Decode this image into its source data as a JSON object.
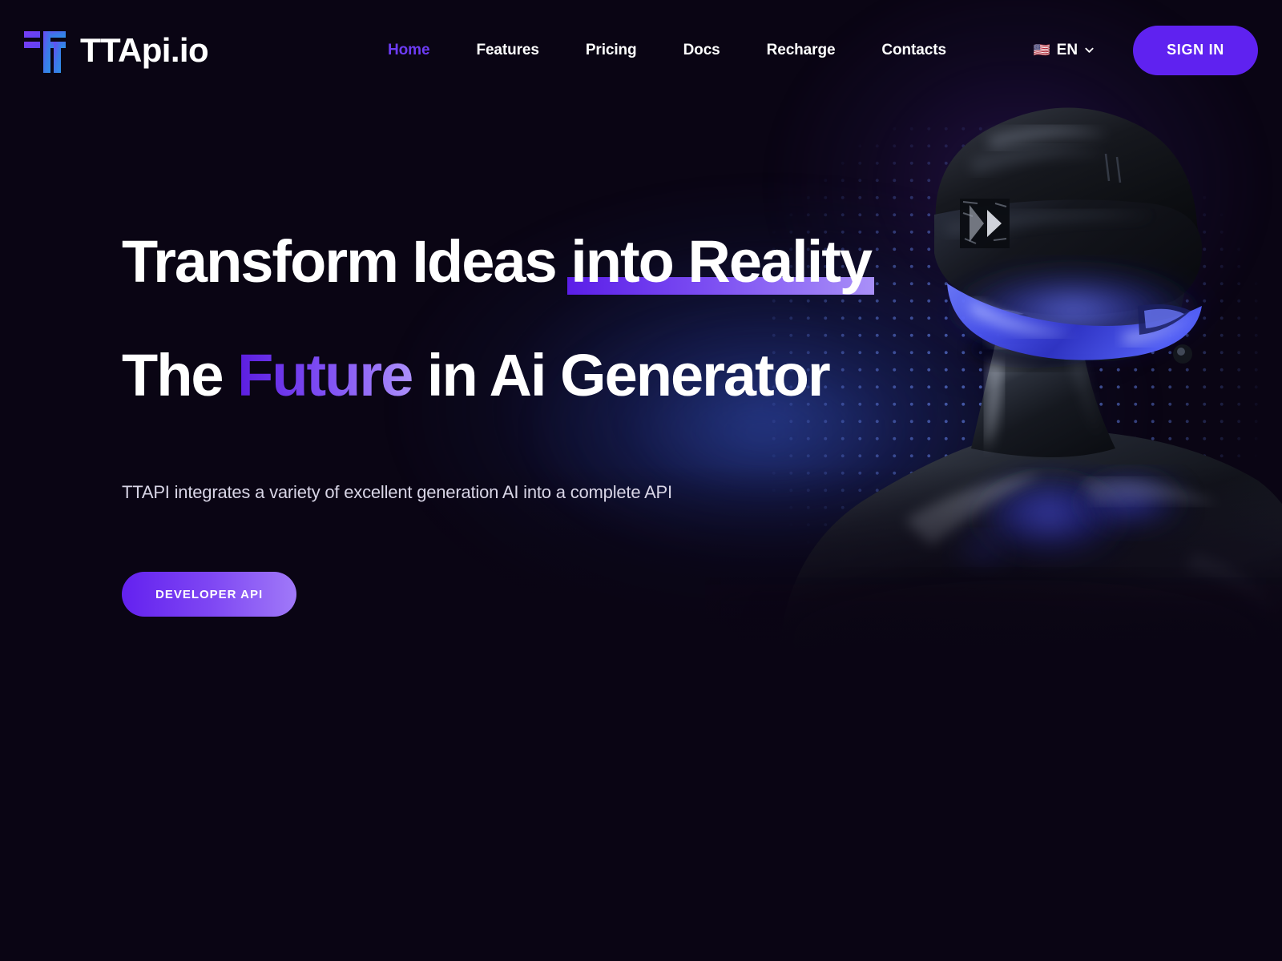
{
  "brand": {
    "name": "TTApi.io",
    "logo_icon": "ttapi-logo-icon",
    "logo_colors": {
      "accent_purple": "#6d3cf5",
      "accent_blue": "#2f7fe8"
    }
  },
  "nav": {
    "items": [
      {
        "label": "Home",
        "active": true
      },
      {
        "label": "Features",
        "active": false
      },
      {
        "label": "Pricing",
        "active": false
      },
      {
        "label": "Docs",
        "active": false
      },
      {
        "label": "Recharge",
        "active": false
      },
      {
        "label": "Contacts",
        "active": false
      }
    ]
  },
  "header": {
    "language": {
      "flag_icon": "us-flag-icon",
      "flag": "🇺🇸",
      "code": "EN",
      "chevron_icon": "chevron-down-icon"
    },
    "signin_label": "SIGN IN"
  },
  "hero": {
    "headline_line1_plain": "Transform Ideas ",
    "headline_line1_highlight": "into Reality",
    "headline_line2_pre": "The ",
    "headline_line2_gradient": "Future",
    "headline_line2_post": " in Ai Generator",
    "subtitle": "TTAPI integrates a variety of excellent generation AI into a complete API",
    "cta_label": "DEVELOPER API",
    "image_alt": "ai-robot-with-vr-visor",
    "background_icon": "dot-matrix-pattern"
  },
  "colors": {
    "page_background": "#0a0514",
    "accent_purple": "#6d3cf5",
    "signin_purple": "#5f22f0",
    "highlight_from": "#5b1ee8",
    "highlight_to": "#a990f8",
    "glow_blue": "#283e96",
    "text_primary": "#ffffff",
    "text_secondary": "#d8d5e6"
  }
}
